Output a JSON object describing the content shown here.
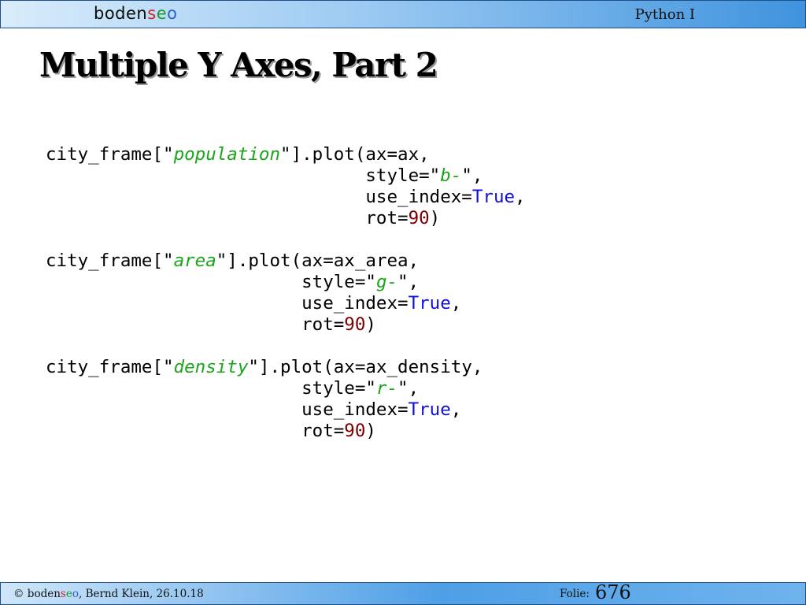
{
  "header": {
    "logo": {
      "part1": "boden",
      "part2": "s",
      "part3": "e",
      "part4": "o"
    },
    "course": "Python I"
  },
  "slide": {
    "title": "Multiple Y Axes, Part 2"
  },
  "code": {
    "block1": {
      "l1_pre": "city_frame[\"",
      "l1_str": "population",
      "l1_post": "\"].plot(ax=ax,",
      "l2_pre": "                              style=\"",
      "l2_str": "b-",
      "l2_post": "\",",
      "l3_pre": "                              use_index=",
      "l3_kw": "True",
      "l3_post": ",",
      "l4_pre": "                              rot=",
      "l4_num": "90",
      "l4_post": ")"
    },
    "block2": {
      "l1_pre": "city_frame[\"",
      "l1_str": "area",
      "l1_post": "\"].plot(ax=ax_area,",
      "l2_pre": "                        style=\"",
      "l2_str": "g-",
      "l2_post": "\",",
      "l3_pre": "                        use_index=",
      "l3_kw": "True",
      "l3_post": ",",
      "l4_pre": "                        rot=",
      "l4_num": "90",
      "l4_post": ")"
    },
    "block3": {
      "l1_pre": "city_frame[\"",
      "l1_str": "density",
      "l1_post": "\"].plot(ax=ax_density,",
      "l2_pre": "                        style=\"",
      "l2_str": "r-",
      "l2_post": "\",",
      "l3_pre": "                        use_index=",
      "l3_kw": "True",
      "l3_post": ",",
      "l4_pre": "                        rot=",
      "l4_num": "90",
      "l4_post": ")"
    }
  },
  "footer": {
    "copyright": "© ",
    "brand": {
      "part1": "boden",
      "part2": "s",
      "part3": "e",
      "part4": "o"
    },
    "author_date": ", Bernd Klein, 26.10.18",
    "folie_label": "Folie:",
    "page_number": "676"
  },
  "colors": {
    "string": "#1aa51a",
    "keyword": "#1010d8",
    "number": "#7a0000",
    "header_accent": "#3f93de"
  }
}
